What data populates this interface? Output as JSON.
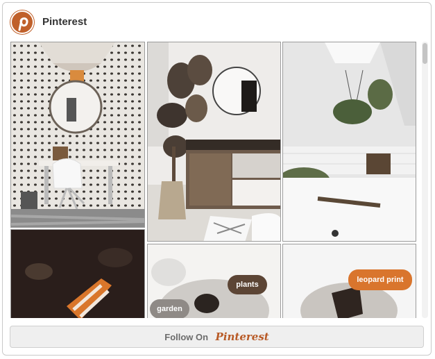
{
  "header": {
    "brand": "Pinterest",
    "logo_icon": "pinterest-logo-icon"
  },
  "pins": [
    {
      "name": "pin-wallpaper-desk"
    },
    {
      "name": "pin-sideboard-fiddle-leaf"
    },
    {
      "name": "pin-bathroom-plants"
    },
    {
      "name": "pin-dark-textile"
    },
    {
      "name": "pin-plants-garden",
      "tags": [
        "plants",
        "garden"
      ]
    },
    {
      "name": "pin-leopard-print",
      "tags": [
        "leopard print"
      ]
    }
  ],
  "footer": {
    "follow_label": "Follow On",
    "brand_script": "Pinterest"
  },
  "colors": {
    "accent": "#c0602a",
    "tag_dark": "#5c4535",
    "tag_gray": "#8f8a86",
    "tag_orange": "#d9752d"
  }
}
